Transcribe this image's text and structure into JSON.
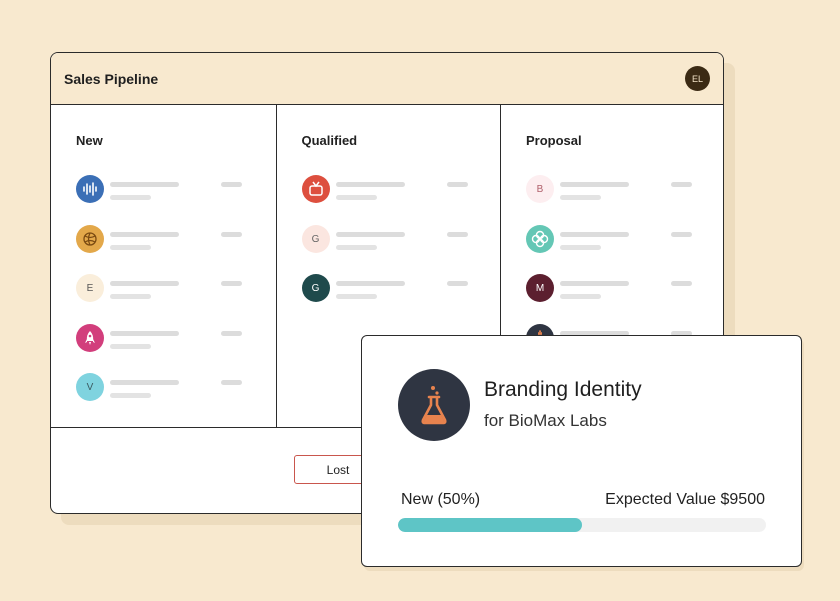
{
  "window": {
    "title": "Sales Pipeline",
    "user_initials": "EL"
  },
  "columns": [
    {
      "title": "New",
      "deals": [
        {
          "icon": "audio-wave-icon",
          "letter": "",
          "bg": "#3b6fb6",
          "fg": "#ffffff"
        },
        {
          "icon": "globe-icon",
          "letter": "",
          "bg": "#e3a84a",
          "fg": "#7a4a12"
        },
        {
          "icon": "letter-avatar",
          "letter": "E",
          "bg": "#faeedb",
          "fg": "#555555"
        },
        {
          "icon": "rocket-icon",
          "letter": "",
          "bg": "#d23e7c",
          "fg": "#ffffff"
        },
        {
          "icon": "letter-avatar",
          "letter": "V",
          "bg": "#7fd3df",
          "fg": "#3a5a60"
        }
      ]
    },
    {
      "title": "Qualified",
      "deals": [
        {
          "icon": "tv-icon",
          "letter": "",
          "bg": "#dd4f3e",
          "fg": "#ffffff"
        },
        {
          "icon": "letter-avatar",
          "letter": "G",
          "bg": "#fbe6e0",
          "fg": "#666666"
        },
        {
          "icon": "letter-avatar",
          "letter": "G",
          "bg": "#1f4a4c",
          "fg": "#ffffff"
        }
      ]
    },
    {
      "title": "Proposal",
      "deals": [
        {
          "icon": "letter-avatar",
          "letter": "B",
          "bg": "#fdeef0",
          "fg": "#b0606b"
        },
        {
          "icon": "flower-icon",
          "letter": "",
          "bg": "#64c7b5",
          "fg": "#ffffff"
        },
        {
          "icon": "letter-avatar",
          "letter": "M",
          "bg": "#5c1f2f",
          "fg": "#ffffff"
        },
        {
          "icon": "flask-icon",
          "letter": "",
          "bg": "#2f3542",
          "fg": "#e8834e"
        }
      ]
    }
  ],
  "footer": {
    "lost_label": "Lost"
  },
  "card": {
    "title": "Branding Identity",
    "subtitle": "for BioMax Labs",
    "logo_icon": "flask-icon",
    "stage_label": "New (50%)",
    "expected_value_label": "Expected Value $9500",
    "progress_fraction": 0.5,
    "progress_color": "#5ec5c6"
  }
}
